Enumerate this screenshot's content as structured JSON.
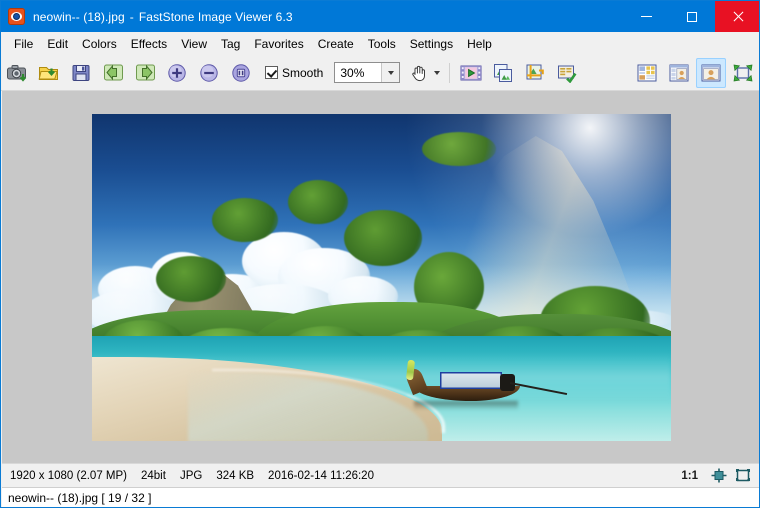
{
  "window": {
    "app_icon": "faststone-eye-icon",
    "file_name": "neowin-- (18).jpg",
    "separator": "-",
    "app_title": "FastStone Image Viewer 6.3",
    "controls": {
      "minimize": "minimize-button",
      "maximize": "maximize-button",
      "close": "close-button"
    },
    "accent_color": "#0078d7",
    "close_color": "#e81123"
  },
  "menubar": {
    "items": [
      {
        "label": "File"
      },
      {
        "label": "Edit"
      },
      {
        "label": "Colors"
      },
      {
        "label": "Effects"
      },
      {
        "label": "View"
      },
      {
        "label": "Tag"
      },
      {
        "label": "Favorites"
      },
      {
        "label": "Create"
      },
      {
        "label": "Tools"
      },
      {
        "label": "Settings"
      },
      {
        "label": "Help"
      }
    ]
  },
  "toolbar": {
    "buttons_left": [
      {
        "icon": "screen-capture-icon",
        "title": "Screen Capture"
      },
      {
        "icon": "open-folder-icon",
        "title": "Open"
      },
      {
        "icon": "save-floppy-icon",
        "title": "Save As"
      },
      {
        "icon": "previous-arrow-icon",
        "title": "Previous"
      },
      {
        "icon": "next-arrow-icon",
        "title": "Next"
      },
      {
        "icon": "zoom-in-icon",
        "title": "Zoom In"
      },
      {
        "icon": "zoom-out-icon",
        "title": "Zoom Out"
      },
      {
        "icon": "actual-size-icon",
        "title": "Actual Size"
      }
    ],
    "smooth": {
      "label": "Smooth",
      "checked": true
    },
    "zoom": {
      "value": "30%"
    },
    "hand_tool": {
      "icon": "hand-pan-icon"
    },
    "buttons_mid": [
      {
        "icon": "slideshow-film-icon",
        "title": "Slide Show"
      },
      {
        "icon": "compare-images-icon",
        "title": "Compare Selected Images"
      },
      {
        "icon": "crop-board-icon",
        "title": "Crop Board"
      },
      {
        "icon": "jpeg-lossless-icon",
        "title": "JPEG Lossless Rotate"
      }
    ],
    "buttons_right": [
      {
        "icon": "thumbnail-browser-icon",
        "title": "Browser",
        "active": false
      },
      {
        "icon": "filmstrip-view-icon",
        "title": "Filmstrip",
        "active": false
      },
      {
        "icon": "single-image-view-icon",
        "title": "Image View",
        "active": true
      },
      {
        "icon": "fullscreen-icon",
        "title": "Full Screen",
        "active": false
      }
    ],
    "active_highlight": "#cce8ff"
  },
  "viewer": {
    "canvas_background": "#c8c8c8",
    "photo_alt": "Tropical beach with limestone karst cliffs, longtail boat and turquoise water"
  },
  "statusbar": {
    "dimensions": "1920 x 1080 (2.07 MP)",
    "bit_depth": "24bit",
    "format": "JPG",
    "file_size": "324 KB",
    "timestamp": "2016-02-14 11:26:20",
    "ratio": "1:1",
    "icons": [
      {
        "icon": "fit-window-icon"
      },
      {
        "icon": "fullscreen-toggle-icon"
      }
    ]
  },
  "bottombar": {
    "text": "neowin-- (18).jpg [ 19 / 32 ]"
  }
}
